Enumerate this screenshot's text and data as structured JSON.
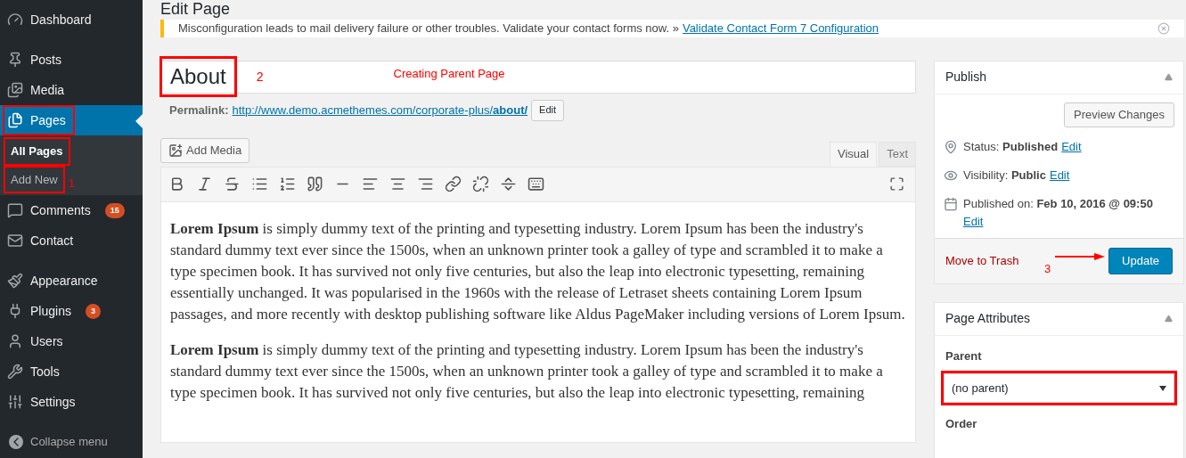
{
  "sidebar": {
    "groups": [
      [
        {
          "label": "Dashboard",
          "selected": false
        }
      ],
      [
        {
          "label": "Posts",
          "selected": false
        },
        {
          "label": "Media",
          "selected": false
        },
        {
          "label": "Pages",
          "selected": true,
          "highlighted": true,
          "submenu": [
            {
              "label": "All Pages",
              "selected": true,
              "highlighted": true
            },
            {
              "label": "Add New",
              "selected": false,
              "highlighted": true,
              "annotation": "1"
            }
          ]
        },
        {
          "label": "Comments",
          "selected": false,
          "badge": "15"
        },
        {
          "label": "Contact",
          "selected": false
        }
      ],
      [
        {
          "label": "Appearance",
          "selected": false
        },
        {
          "label": "Plugins",
          "selected": false,
          "badge": "3"
        },
        {
          "label": "Users",
          "selected": false
        },
        {
          "label": "Tools",
          "selected": false
        },
        {
          "label": "Settings",
          "selected": false
        }
      ]
    ],
    "collapse": "Collapse menu"
  },
  "heading": "Edit Page",
  "notice": {
    "text": "Misconfiguration leads to mail delivery failure or other troubles. Validate your contact forms now. »",
    "link": "Validate Contact Form 7 Configuration"
  },
  "title_field": {
    "value": "About",
    "highlighted": true,
    "annotation_number": "2",
    "annotation_text": "Creating Parent Page"
  },
  "permalink": {
    "label": "Permalink:",
    "url": "http://www.demo.acmethemes.com/corporate-plus/**about/**",
    "button": "Edit"
  },
  "editor": {
    "add_media": "Add Media",
    "tabs": [
      {
        "label": "Visual",
        "selected": true
      },
      {
        "label": "Text",
        "selected": false
      }
    ],
    "paragraphs": [
      "**Lorem Ipsum** is simply dummy text of the printing and typesetting industry. Lorem Ipsum has been the industry's standard dummy text ever since the 1500s, when an unknown printer took a galley of type and scrambled it to make a type specimen book. It has survived not only five centuries, but also the leap into electronic typesetting, remaining essentially unchanged. It was popularised in the 1960s with the release of Letraset sheets containing Lorem Ipsum passages, and more recently with desktop publishing software like Aldus PageMaker including versions of Lorem Ipsum.",
      "**Lorem Ipsum** is simply dummy text of the printing and typesetting industry. Lorem Ipsum has been the industry's standard dummy text ever since the 1500s, when an unknown printer took a galley of type and scrambled it to make a type specimen book. It has survived not only five centuries, but also the leap into electronic typesetting, remaining"
    ]
  },
  "publish": {
    "title": "Publish",
    "preview": "Preview Changes",
    "rows": [
      {
        "text": "Status: **Published**",
        "link": "Edit"
      },
      {
        "text": "Visibility: **Public**",
        "link": "Edit"
      },
      {
        "text": "Published on: **Feb 10, 2016 @ 09:50**",
        "link": "Edit"
      }
    ],
    "trash": "Move to Trash",
    "annotation": "3",
    "update": "Update"
  },
  "attributes": {
    "title": "Page Attributes",
    "parent_label": "Parent",
    "parent_value": "(no parent)",
    "parent_highlighted": true,
    "order_label": "Order"
  }
}
